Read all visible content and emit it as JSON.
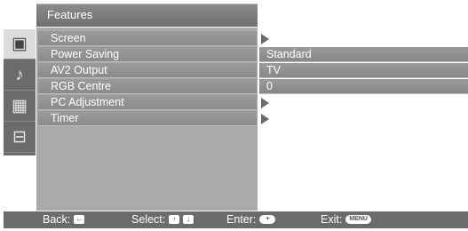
{
  "header": {
    "title": "Features"
  },
  "sidebar": {
    "items": [
      {
        "icon": "picture-icon",
        "glyph": "▣"
      },
      {
        "icon": "music-note-icon",
        "glyph": "♪"
      },
      {
        "icon": "channel-list-icon",
        "glyph": "▦"
      },
      {
        "icon": "toolbox-icon",
        "glyph": "⊟"
      }
    ]
  },
  "menu": {
    "items": [
      {
        "label": "Screen",
        "value": null,
        "submenu": true
      },
      {
        "label": "Power Saving",
        "value": "Standard",
        "submenu": false
      },
      {
        "label": "AV2 Output",
        "value": "TV",
        "submenu": false
      },
      {
        "label": "RGB Centre",
        "value": "0",
        "submenu": false
      },
      {
        "label": "PC Adjustment",
        "value": null,
        "submenu": true
      },
      {
        "label": "Timer",
        "value": null,
        "submenu": true
      }
    ]
  },
  "footer": {
    "back_label": "Back:",
    "back_key": "←",
    "select_label": "Select:",
    "select_key_up": "↑",
    "select_key_down": "↓",
    "enter_label": "Enter:",
    "enter_key": "+",
    "exit_label": "Exit:",
    "exit_key": "MENU"
  }
}
